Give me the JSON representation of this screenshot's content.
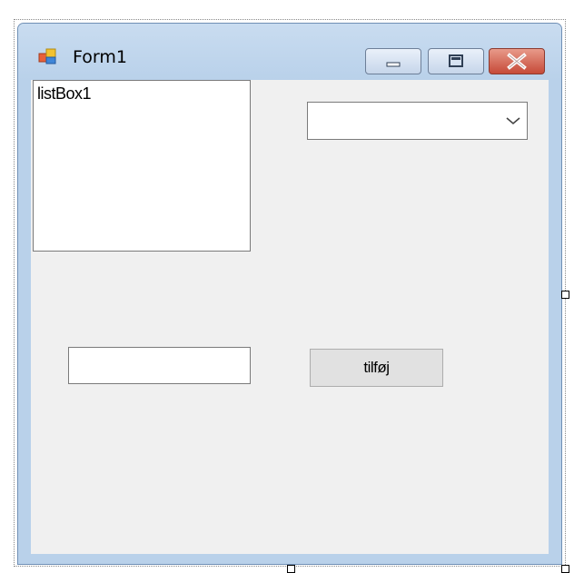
{
  "window": {
    "title": "Form1",
    "icon": "form-app-icon"
  },
  "caption_buttons": {
    "minimize_icon": "minimize-icon",
    "maximize_icon": "maximize-icon",
    "close_icon": "close-icon",
    "close_color": "#c64a38"
  },
  "listbox": {
    "items": [
      "listBox1"
    ]
  },
  "combobox": {
    "value": "",
    "arrow_icon": "chevron-down-icon"
  },
  "textbox": {
    "value": ""
  },
  "add_button": {
    "label": "tilføj"
  },
  "colors": {
    "frame": "#b9d1ea",
    "client": "#f0f0f0",
    "button": "#e1e1e1"
  }
}
